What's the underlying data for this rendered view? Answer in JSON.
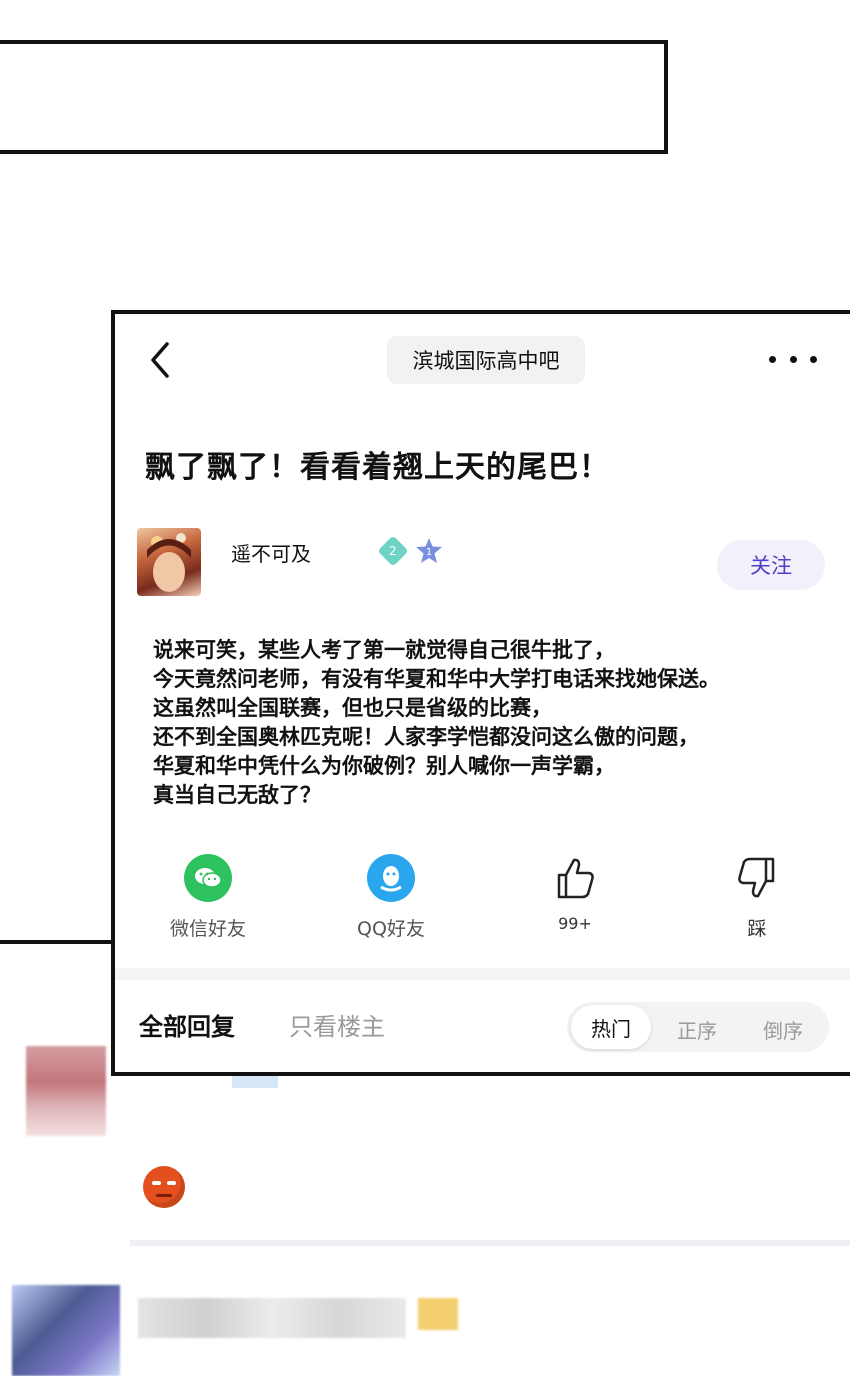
{
  "header": {
    "forum_name": "滨城国际高中吧",
    "back_icon": "chevron-left-icon",
    "more_icon": "more-dots-icon"
  },
  "post": {
    "title": "飘了飘了！看看着翘上天的尾巴！",
    "author": {
      "name": "遥不可及",
      "level_badge": "2",
      "rank_badge": "1"
    },
    "follow_label": "关注",
    "body_lines": [
      "说来可笑，某些人考了第一就觉得自己很牛批了，",
      "今天竟然问老师，有没有华夏和华中大学打电话来找她保送。",
      "这虽然叫全国联赛，但也只是省级的比赛，",
      "还不到全国奥林匹克呢！人家李学恺都没问这么傲的问题，",
      "华夏和华中凭什么为你破例？别人喊你一声学霸，",
      "真当自己无敌了？"
    ]
  },
  "actions": {
    "wechat": "微信好友",
    "qq": "QQ好友",
    "like_count": "99+",
    "dislike": "踩"
  },
  "reply_tabs": {
    "all": "全部回复",
    "op_only": "只看楼主",
    "sort_hot": "热门",
    "sort_asc": "正序",
    "sort_desc": "倒序"
  },
  "colors": {
    "accent": "#4e40c9",
    "wechat": "#2dc160",
    "qq": "#2aa6ee"
  }
}
